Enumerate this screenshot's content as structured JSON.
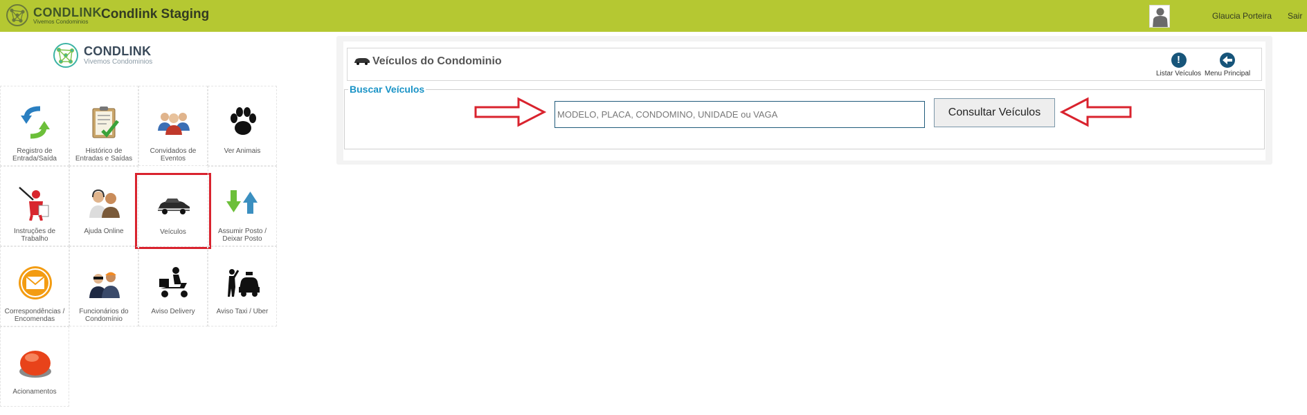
{
  "topbar": {
    "brand": "CONDLINK",
    "brand_tagline": "Vivemos Condominios",
    "app_title": "Condlink Staging",
    "user_name": "Glaucia Porteira",
    "exit_label": "Sair"
  },
  "sidebar": {
    "logo_name": "CONDLINK",
    "logo_tagline": "Vivemos Condominios",
    "tiles": [
      {
        "label": "Registro de Entrada/Saída",
        "icon": "entry-exit-arrows-icon"
      },
      {
        "label": "Histórico de Entradas e Saídas",
        "icon": "clipboard-check-icon"
      },
      {
        "label": "Convidados de Eventos",
        "icon": "guests-group-icon"
      },
      {
        "label": "Ver Animais",
        "icon": "paw-icon"
      },
      {
        "label": "Instruções de Trabalho",
        "icon": "instructor-icon"
      },
      {
        "label": "Ajuda Online",
        "icon": "online-help-people-icon"
      },
      {
        "label": "Veículos",
        "icon": "car-icon",
        "selected": true
      },
      {
        "label": "Assumir Posto / Deixar Posto",
        "icon": "up-down-arrows-icon"
      },
      {
        "label": "Correspondências / Encomendas",
        "icon": "envelope-icon"
      },
      {
        "label": "Funcionários do Condomínio",
        "icon": "staff-icon"
      },
      {
        "label": "Aviso Delivery",
        "icon": "delivery-scooter-icon"
      },
      {
        "label": "Aviso Taxi / Uber",
        "icon": "taxi-icon"
      },
      {
        "label": "Acionamentos",
        "icon": "red-button-icon"
      }
    ]
  },
  "main": {
    "title": "Veículos do Condominio",
    "list_button": "Listar Veículos",
    "menu_button": "Menu Principal",
    "section_legend": "Buscar Veículos",
    "search_placeholder": "MODELO, PLACA, CONDOMINO, UNIDADE ou VAGA",
    "search_value": "",
    "search_button": "Consultar Veículos"
  },
  "colors": {
    "topbar": "#b5c832",
    "legend": "#1a93c6",
    "selected_border": "#d9232e",
    "nav_button": "#17557a",
    "annotation_arrow": "#d9232e"
  }
}
